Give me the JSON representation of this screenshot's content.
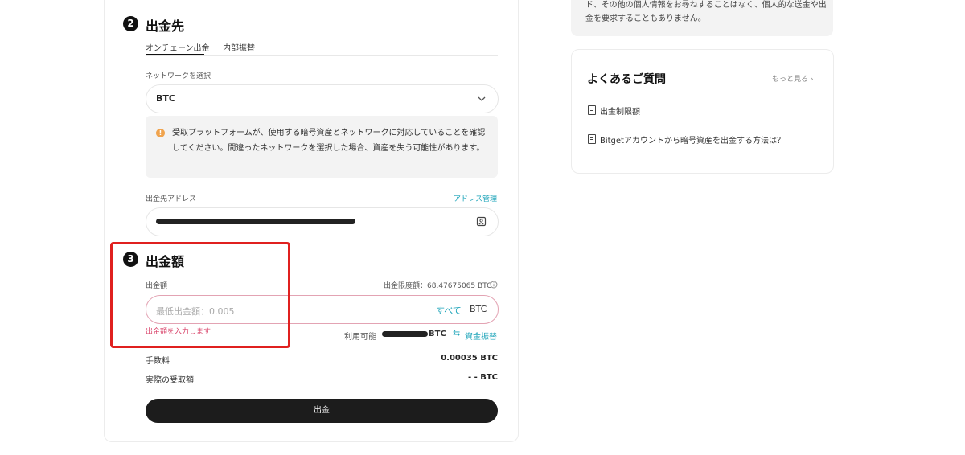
{
  "step2": {
    "number": "2",
    "title": "出金先",
    "tabs": [
      "オンチェーン出金",
      "内部振替"
    ],
    "network_label": "ネットワークを選択",
    "network_value": "BTC",
    "notice": "受取プラットフォームが、使用する暗号資産とネットワークに対応していることを確認してください。間違ったネットワークを選択した場合、資産を失う可能性があります。",
    "address_label": "出金先アドレス",
    "address_manage": "アドレス管理"
  },
  "step3": {
    "number": "3",
    "title": "出金額",
    "amount_label": "出金額",
    "limit_text": "出金限度額：68.47675065 BTC",
    "placeholder": "最低出金額：0.005",
    "all_label": "すべて",
    "currency": "BTC",
    "error": "出金額を入力します",
    "available_label": "利用可能",
    "available_suffix": "BTC",
    "transfer_label": "資金振替"
  },
  "summary": {
    "fee_label": "手数料",
    "fee_value": "0.00035 BTC",
    "received_label": "実際の受取額",
    "received_value": "- - BTC"
  },
  "withdraw_button": "出金",
  "sidebar": {
    "notice_text": "ド、その他の個人情報をお尋ねすることはなく、個人的な送金や出金を要求することもありません。",
    "faq_title": "よくあるご質問",
    "faq_more": "もっと見る",
    "faq_items": [
      "出金制限額",
      "Bitgetアカウントから暗号資産を出金する方法は？"
    ]
  },
  "colors": {
    "accent": "#1aa3b8",
    "error": "#d9456b",
    "highlight_box": "#e0201f",
    "button": "#1c1c1c"
  }
}
